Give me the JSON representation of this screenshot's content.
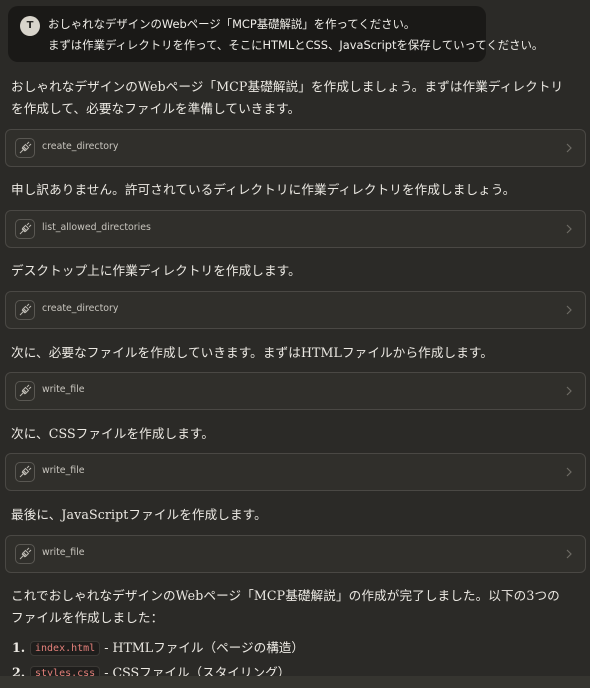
{
  "user_message": {
    "avatar_initial": "T",
    "line1": "おしゃれなデザインのWebページ「MCP基礎解説」を作ってください。",
    "line2": "まずは作業ディレクトリを作って、そこにHTMLとCSS、JavaScriptを保存していってください。"
  },
  "intro": {
    "line1": "おしゃれなデザインのWebページ「MCP基礎解説」を作成しましょう。まずは作業ディレクトリ",
    "line2": "を作成して、必要なファイルを準備していきます。"
  },
  "tools": [
    {
      "label": "create_directory"
    },
    {
      "label": "list_allowed_directories"
    },
    {
      "label": "create_directory"
    },
    {
      "label": "write_file"
    },
    {
      "label": "write_file"
    },
    {
      "label": "write_file"
    }
  ],
  "messages": [
    "申し訳ありません。許可されているディレクトリに作業ディレクトリを作成しましょう。",
    "デスクトップ上に作業ディレクトリを作成します。",
    "次に、必要なファイルを作成していきます。まずはHTMLファイルから作成します。",
    "次に、CSSファイルを作成します。",
    "最後に、JavaScriptファイルを作成します。"
  ],
  "conclusion": {
    "line1": "これでおしゃれなデザインのWebページ「MCP基礎解説」の作成が完了しました。以下の3つの",
    "line2": "ファイルを作成しました："
  },
  "file_list": [
    {
      "num": "1.",
      "file": "index.html",
      "desc": "- HTMLファイル（ページの構造）"
    },
    {
      "num": "2.",
      "file": "styles.css",
      "desc": "- CSSファイル（スタイリング）"
    }
  ]
}
